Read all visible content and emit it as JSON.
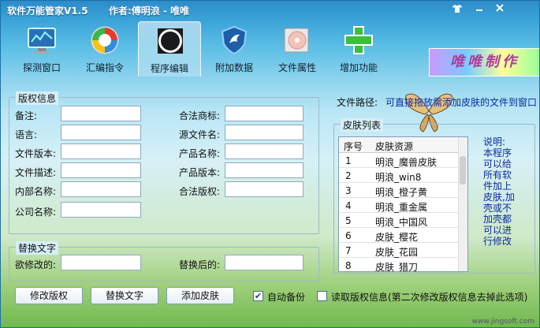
{
  "titlebar": {
    "app_title": "软件万能管家V1.5",
    "author": "作者:傅明浪 - 唯唯",
    "buttons": [
      "shirt",
      "minimize",
      "close"
    ]
  },
  "toolbar": {
    "items": [
      {
        "label": "探测窗口",
        "icon": "monitor-icon",
        "active": false
      },
      {
        "label": "汇编指令",
        "icon": "refresh-icon",
        "active": false
      },
      {
        "label": "程序编辑",
        "icon": "blank-icon",
        "active": true
      },
      {
        "label": "附加数据",
        "icon": "shield-icon",
        "active": false
      },
      {
        "label": "文件属性",
        "icon": "disc-icon",
        "active": false
      },
      {
        "label": "增加功能",
        "icon": "plus-icon",
        "active": false
      }
    ],
    "banner": "唯唯制作"
  },
  "copyright": {
    "legend": "版权信息",
    "fields": [
      {
        "label": "备注:",
        "value": ""
      },
      {
        "label": "语言:",
        "value": ""
      },
      {
        "label": "文件版本:",
        "value": ""
      },
      {
        "label": "文件描述:",
        "value": ""
      },
      {
        "label": "内部名称:",
        "value": ""
      },
      {
        "label": "公司名称:",
        "value": ""
      }
    ],
    "fields_right": [
      {
        "label": "合法商标:",
        "value": ""
      },
      {
        "label": "源文件名:",
        "value": ""
      },
      {
        "label": "产品名称:",
        "value": ""
      },
      {
        "label": "产品版本:",
        "value": ""
      },
      {
        "label": "合法版权:",
        "value": ""
      }
    ]
  },
  "replace": {
    "legend": "替换文字",
    "before_label": "欲修改的:",
    "before_value": "",
    "after_label": "替换后的:",
    "after_value": ""
  },
  "path": {
    "label": "文件路径:",
    "hint": "可直接拖放需添加皮肤的文件到窗口"
  },
  "skins": {
    "legend": "皮肤列表",
    "col_no": "序号",
    "col_name": "皮肤资源",
    "rows": [
      {
        "no": "1",
        "name": "明浪_魔兽皮肤"
      },
      {
        "no": "2",
        "name": "明浪_win8"
      },
      {
        "no": "3",
        "name": "明浪_橙子黄"
      },
      {
        "no": "4",
        "name": "明浪_重金属"
      },
      {
        "no": "5",
        "name": "明浪_中国风"
      },
      {
        "no": "6",
        "name": "皮肤_樱花"
      },
      {
        "no": "7",
        "name": "皮肤_花园"
      },
      {
        "no": "8",
        "name": "皮肤_猎刀"
      }
    ]
  },
  "note": "说明:本程序可以给所有软件加上皮肤,加壳或不加壳都可以进行修改",
  "buttons": {
    "modify": "修改版权",
    "replace": "替换文字",
    "add_skin": "添加皮肤"
  },
  "options": {
    "auto_backup_label": "自动备份",
    "auto_backup_checked": true,
    "read_info_label": "读取版权信息(第二次修改版权信息去掉此选项)",
    "read_info_checked": false
  },
  "watermark": "www.jingsoft.com"
}
